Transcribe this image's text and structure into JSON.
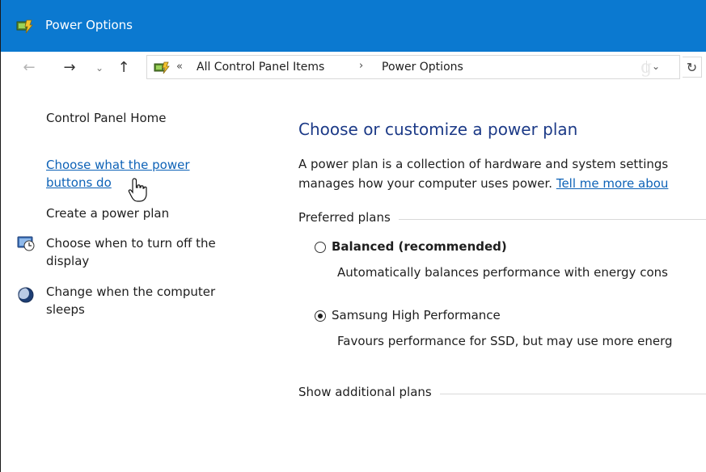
{
  "window": {
    "title": "Power Options",
    "accent_color": "#0b79d0"
  },
  "nav": {
    "back_icon": "back-arrow-icon",
    "forward_icon": "forward-arrow-icon",
    "recent_icon": "chevron-down-icon",
    "up_icon": "up-arrow-icon"
  },
  "address": {
    "overflow": "«",
    "crumbs": [
      "All Control Panel Items",
      "Power Options"
    ],
    "separator": "›",
    "watermark": "g",
    "dropdown": "⌄",
    "refresh": "↻"
  },
  "sidebar": {
    "items": [
      {
        "label": "Control Panel Home"
      },
      {
        "label": "Choose what the power buttons do"
      },
      {
        "label": "Create a power plan"
      },
      {
        "label": "Choose when to turn off the display",
        "icon": "display-timer-icon"
      },
      {
        "label": "Change when the computer sleeps",
        "icon": "sleep-moon-icon"
      }
    ]
  },
  "main": {
    "heading": "Choose or customize a power plan",
    "desc_line1": "A power plan is a collection of hardware and system settings",
    "desc_line2": "manages how your computer uses power. ",
    "desc_link": "Tell me more abou",
    "preferred_label": "Preferred plans",
    "plans": [
      {
        "name": "Balanced (recommended)",
        "desc": "Automatically balances performance with energy cons",
        "selected": false
      },
      {
        "name": "Samsung High Performance",
        "desc": "Favours performance for SSD, but may use more energ",
        "selected": true
      }
    ],
    "additional_label": "Show additional plans"
  }
}
